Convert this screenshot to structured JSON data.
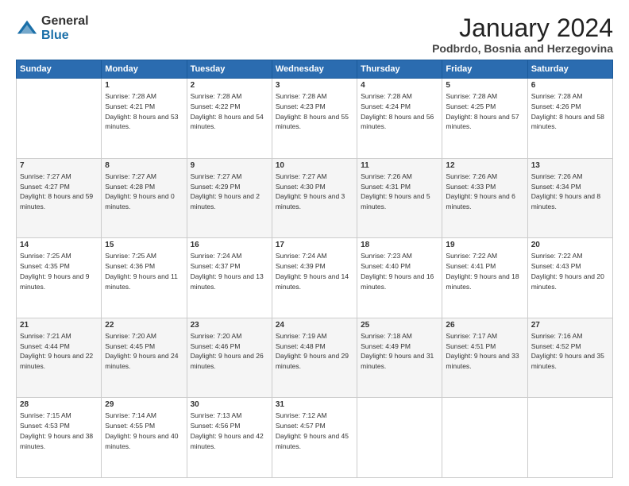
{
  "logo": {
    "general": "General",
    "blue": "Blue"
  },
  "header": {
    "month": "January 2024",
    "location": "Podbrdo, Bosnia and Herzegovina"
  },
  "weekdays": [
    "Sunday",
    "Monday",
    "Tuesday",
    "Wednesday",
    "Thursday",
    "Friday",
    "Saturday"
  ],
  "weeks": [
    [
      {
        "day": "",
        "sunrise": "",
        "sunset": "",
        "daylight": ""
      },
      {
        "day": "1",
        "sunrise": "Sunrise: 7:28 AM",
        "sunset": "Sunset: 4:21 PM",
        "daylight": "Daylight: 8 hours and 53 minutes."
      },
      {
        "day": "2",
        "sunrise": "Sunrise: 7:28 AM",
        "sunset": "Sunset: 4:22 PM",
        "daylight": "Daylight: 8 hours and 54 minutes."
      },
      {
        "day": "3",
        "sunrise": "Sunrise: 7:28 AM",
        "sunset": "Sunset: 4:23 PM",
        "daylight": "Daylight: 8 hours and 55 minutes."
      },
      {
        "day": "4",
        "sunrise": "Sunrise: 7:28 AM",
        "sunset": "Sunset: 4:24 PM",
        "daylight": "Daylight: 8 hours and 56 minutes."
      },
      {
        "day": "5",
        "sunrise": "Sunrise: 7:28 AM",
        "sunset": "Sunset: 4:25 PM",
        "daylight": "Daylight: 8 hours and 57 minutes."
      },
      {
        "day": "6",
        "sunrise": "Sunrise: 7:28 AM",
        "sunset": "Sunset: 4:26 PM",
        "daylight": "Daylight: 8 hours and 58 minutes."
      }
    ],
    [
      {
        "day": "7",
        "sunrise": "Sunrise: 7:27 AM",
        "sunset": "Sunset: 4:27 PM",
        "daylight": "Daylight: 8 hours and 59 minutes."
      },
      {
        "day": "8",
        "sunrise": "Sunrise: 7:27 AM",
        "sunset": "Sunset: 4:28 PM",
        "daylight": "Daylight: 9 hours and 0 minutes."
      },
      {
        "day": "9",
        "sunrise": "Sunrise: 7:27 AM",
        "sunset": "Sunset: 4:29 PM",
        "daylight": "Daylight: 9 hours and 2 minutes."
      },
      {
        "day": "10",
        "sunrise": "Sunrise: 7:27 AM",
        "sunset": "Sunset: 4:30 PM",
        "daylight": "Daylight: 9 hours and 3 minutes."
      },
      {
        "day": "11",
        "sunrise": "Sunrise: 7:26 AM",
        "sunset": "Sunset: 4:31 PM",
        "daylight": "Daylight: 9 hours and 5 minutes."
      },
      {
        "day": "12",
        "sunrise": "Sunrise: 7:26 AM",
        "sunset": "Sunset: 4:33 PM",
        "daylight": "Daylight: 9 hours and 6 minutes."
      },
      {
        "day": "13",
        "sunrise": "Sunrise: 7:26 AM",
        "sunset": "Sunset: 4:34 PM",
        "daylight": "Daylight: 9 hours and 8 minutes."
      }
    ],
    [
      {
        "day": "14",
        "sunrise": "Sunrise: 7:25 AM",
        "sunset": "Sunset: 4:35 PM",
        "daylight": "Daylight: 9 hours and 9 minutes."
      },
      {
        "day": "15",
        "sunrise": "Sunrise: 7:25 AM",
        "sunset": "Sunset: 4:36 PM",
        "daylight": "Daylight: 9 hours and 11 minutes."
      },
      {
        "day": "16",
        "sunrise": "Sunrise: 7:24 AM",
        "sunset": "Sunset: 4:37 PM",
        "daylight": "Daylight: 9 hours and 13 minutes."
      },
      {
        "day": "17",
        "sunrise": "Sunrise: 7:24 AM",
        "sunset": "Sunset: 4:39 PM",
        "daylight": "Daylight: 9 hours and 14 minutes."
      },
      {
        "day": "18",
        "sunrise": "Sunrise: 7:23 AM",
        "sunset": "Sunset: 4:40 PM",
        "daylight": "Daylight: 9 hours and 16 minutes."
      },
      {
        "day": "19",
        "sunrise": "Sunrise: 7:22 AM",
        "sunset": "Sunset: 4:41 PM",
        "daylight": "Daylight: 9 hours and 18 minutes."
      },
      {
        "day": "20",
        "sunrise": "Sunrise: 7:22 AM",
        "sunset": "Sunset: 4:43 PM",
        "daylight": "Daylight: 9 hours and 20 minutes."
      }
    ],
    [
      {
        "day": "21",
        "sunrise": "Sunrise: 7:21 AM",
        "sunset": "Sunset: 4:44 PM",
        "daylight": "Daylight: 9 hours and 22 minutes."
      },
      {
        "day": "22",
        "sunrise": "Sunrise: 7:20 AM",
        "sunset": "Sunset: 4:45 PM",
        "daylight": "Daylight: 9 hours and 24 minutes."
      },
      {
        "day": "23",
        "sunrise": "Sunrise: 7:20 AM",
        "sunset": "Sunset: 4:46 PM",
        "daylight": "Daylight: 9 hours and 26 minutes."
      },
      {
        "day": "24",
        "sunrise": "Sunrise: 7:19 AM",
        "sunset": "Sunset: 4:48 PM",
        "daylight": "Daylight: 9 hours and 29 minutes."
      },
      {
        "day": "25",
        "sunrise": "Sunrise: 7:18 AM",
        "sunset": "Sunset: 4:49 PM",
        "daylight": "Daylight: 9 hours and 31 minutes."
      },
      {
        "day": "26",
        "sunrise": "Sunrise: 7:17 AM",
        "sunset": "Sunset: 4:51 PM",
        "daylight": "Daylight: 9 hours and 33 minutes."
      },
      {
        "day": "27",
        "sunrise": "Sunrise: 7:16 AM",
        "sunset": "Sunset: 4:52 PM",
        "daylight": "Daylight: 9 hours and 35 minutes."
      }
    ],
    [
      {
        "day": "28",
        "sunrise": "Sunrise: 7:15 AM",
        "sunset": "Sunset: 4:53 PM",
        "daylight": "Daylight: 9 hours and 38 minutes."
      },
      {
        "day": "29",
        "sunrise": "Sunrise: 7:14 AM",
        "sunset": "Sunset: 4:55 PM",
        "daylight": "Daylight: 9 hours and 40 minutes."
      },
      {
        "day": "30",
        "sunrise": "Sunrise: 7:13 AM",
        "sunset": "Sunset: 4:56 PM",
        "daylight": "Daylight: 9 hours and 42 minutes."
      },
      {
        "day": "31",
        "sunrise": "Sunrise: 7:12 AM",
        "sunset": "Sunset: 4:57 PM",
        "daylight": "Daylight: 9 hours and 45 minutes."
      },
      {
        "day": "",
        "sunrise": "",
        "sunset": "",
        "daylight": ""
      },
      {
        "day": "",
        "sunrise": "",
        "sunset": "",
        "daylight": ""
      },
      {
        "day": "",
        "sunrise": "",
        "sunset": "",
        "daylight": ""
      }
    ]
  ]
}
